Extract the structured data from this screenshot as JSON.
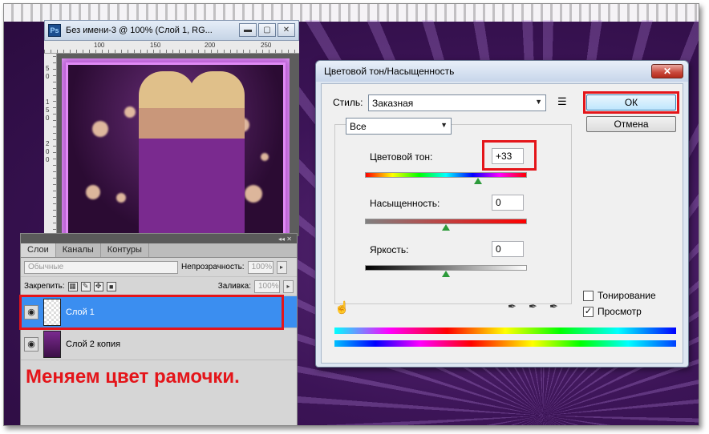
{
  "document_window": {
    "app_badge": "Ps",
    "title": "Без имени-3 @ 100% (Слой 1, RG...",
    "ruler_top_ticks": [
      "100",
      "150",
      "200",
      "250"
    ],
    "ruler_left_ticks": [
      "5",
      "0",
      "1",
      "5",
      "0",
      "2",
      "0",
      "0"
    ]
  },
  "layers_panel": {
    "tabs": [
      "Слои",
      "Каналы",
      "Контуры"
    ],
    "blend_mode": "Обычные",
    "opacity_label": "Непрозрачность:",
    "opacity_value": "100%",
    "lock_label": "Закрепить:",
    "fill_label": "Заливка:",
    "fill_value": "100%",
    "layers": [
      {
        "name": "Слой 1",
        "selected": true
      },
      {
        "name": "Слой 2 копия",
        "selected": false
      }
    ],
    "caption": "Меняем цвет рамочки."
  },
  "dialog": {
    "title": "Цветовой тон/Насыщенность",
    "close_label": "✕",
    "style_label": "Стиль:",
    "style_value": "Заказная",
    "ok_label": "ОК",
    "cancel_label": "Отмена",
    "channel_value": "Все",
    "hue_label": "Цветовой тон:",
    "hue_value": "+33",
    "saturation_label": "Насыщенность:",
    "saturation_value": "0",
    "lightness_label": "Яркость:",
    "lightness_value": "0",
    "colorize_label": "Тонирование",
    "colorize_checked": false,
    "preview_label": "Просмотр",
    "preview_checked": true
  },
  "colors": {
    "highlight_red": "#e4151a",
    "selection_blue": "#3b8ef0",
    "slider_thumb": "#2c9a3a"
  }
}
